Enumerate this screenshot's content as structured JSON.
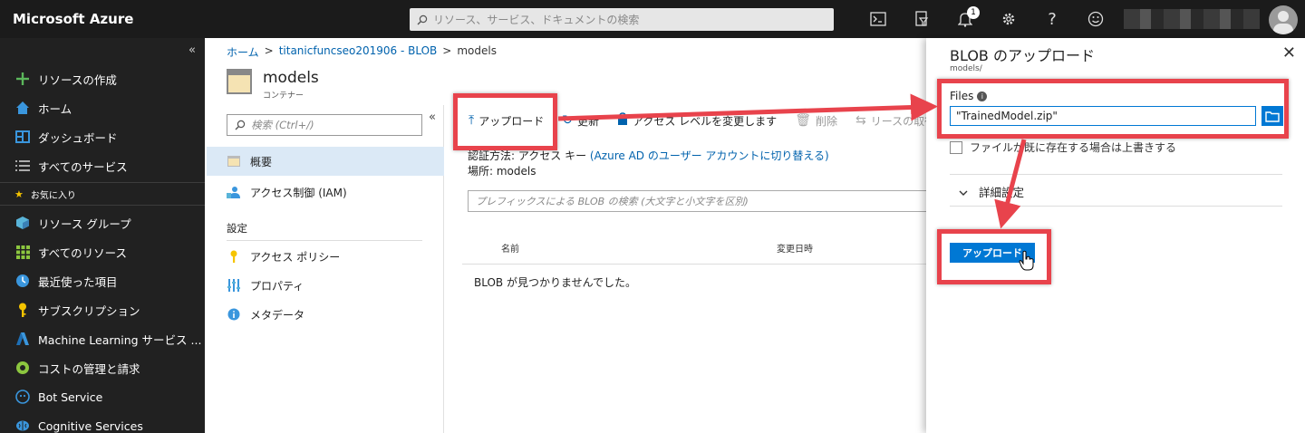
{
  "topbar": {
    "brand": "Microsoft Azure",
    "search_placeholder": "リソース、サービス、ドキュメントの検索",
    "notification_count": "1",
    "icons": [
      "terminal-icon",
      "directory-filter-icon",
      "bell-icon",
      "gear-icon",
      "help-icon",
      "smiley-icon"
    ]
  },
  "leftnav": {
    "collapse": "«",
    "items": [
      {
        "label": "リソースの作成",
        "icon": "plus-icon"
      },
      {
        "label": "ホーム",
        "icon": "home-icon"
      },
      {
        "label": "ダッシュボード",
        "icon": "dashboard-icon"
      },
      {
        "label": "すべてのサービス",
        "icon": "list-icon"
      },
      {
        "label": "お気に入り",
        "icon": "star-icon"
      },
      {
        "label": "リソース グループ",
        "icon": "cube-icon"
      },
      {
        "label": "すべてのリソース",
        "icon": "grid-icon"
      },
      {
        "label": "最近使った項目",
        "icon": "clock-icon"
      },
      {
        "label": "サブスクリプション",
        "icon": "key-icon"
      },
      {
        "label": "Machine Learning サービス ...",
        "icon": "ml-icon"
      },
      {
        "label": "コストの管理と請求",
        "icon": "cost-icon"
      },
      {
        "label": "Bot Service",
        "icon": "bot-icon"
      },
      {
        "label": "Cognitive Services",
        "icon": "brain-icon"
      }
    ]
  },
  "breadcrumb": {
    "home": "ホーム",
    "storage": "titanicfuncseo201906 - BLOB",
    "current": "models",
    "sep": ">"
  },
  "resource": {
    "name": "models",
    "type": "コンテナー"
  },
  "subnav": {
    "search_placeholder": "検索 (Ctrl+/)",
    "collapse": "«",
    "items": [
      {
        "label": "概要",
        "icon": "overview-icon"
      },
      {
        "label": "アクセス制御 (IAM)",
        "icon": "iam-icon"
      }
    ],
    "section": "設定",
    "settings": [
      {
        "label": "アクセス ポリシー",
        "icon": "key-icon"
      },
      {
        "label": "プロパティ",
        "icon": "properties-icon"
      },
      {
        "label": "メタデータ",
        "icon": "info-icon"
      }
    ]
  },
  "toolbar": {
    "upload": "アップロード",
    "refresh": "更新",
    "access": "アクセス レベルを変更します",
    "delete": "削除",
    "lease": "リースの取得"
  },
  "main": {
    "auth_prefix": "認証方法: アクセス キー",
    "auth_link": "(Azure AD のユーザー アカウントに切り替える)",
    "location": "場所: models",
    "blob_search_placeholder": "プレフィックスによる BLOB の検索 (大文字と小文字を区別)",
    "col_name": "名前",
    "col_modified": "変更日時",
    "empty": "BLOB が見つかりませんでした。"
  },
  "blade": {
    "title": "BLOB のアップロード",
    "subtitle": "models/",
    "close": "✕",
    "files_label": "Files",
    "file_value": "\"TrainedModel.zip\"",
    "overwrite": "ファイルが既に存在する場合は上書きする",
    "advanced": "詳細設定",
    "upload_button": "アップロード"
  },
  "colors": {
    "accent": "#0078d4",
    "annotation": "#e8434c",
    "nav_bg": "#212121",
    "topbar_bg": "#1b1b1b"
  }
}
